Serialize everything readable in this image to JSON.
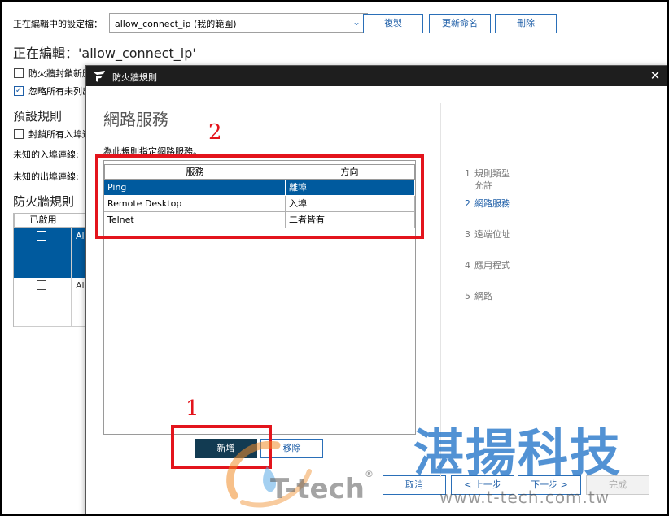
{
  "background_window": {
    "profile_label": "正在編輯中的設定檔：",
    "profile_value": "allow_connect_ip (我的範圍)",
    "copy_button": "複製",
    "rename_button": "更新命名",
    "delete_button": "刪除",
    "editing_title": "正在編輯：'allow_connect_ip'",
    "checkbox_block_new": "防火牆封鎖新應",
    "checkbox_ignore_unlisted": "忽略所有未列出",
    "default_rules_heading": "預設規則",
    "checkbox_block_inbound": "封鎖所有入埠連",
    "unknown_inbound": "未知的入埠連線:",
    "unknown_outbound": "未知的出埠連線:",
    "firewall_rules_heading": "防火牆規則",
    "rules_col_enabled": "已啟用",
    "rule_rows": [
      "All",
      "All"
    ]
  },
  "dialog": {
    "title": "防火牆規則",
    "heading": "網路服務",
    "description": "為此規則指定網路服務。",
    "table": {
      "columns": [
        "服務",
        "方向"
      ],
      "rows": [
        {
          "service": "Ping",
          "direction": "離埠",
          "selected": true
        },
        {
          "service": "Remote Desktop",
          "direction": "入埠",
          "selected": false
        },
        {
          "service": "Telnet",
          "direction": "二者皆有",
          "selected": false
        }
      ]
    },
    "add_button": "新增",
    "remove_button": "移除",
    "cancel_button": "取消",
    "back_button": "< 上一步",
    "next_button": "下一步 >",
    "finish_button": "完成",
    "steps": [
      {
        "num": "1",
        "label": "規則類型",
        "sub": "允許",
        "active": false
      },
      {
        "num": "2",
        "label": "網路服務",
        "sub": "",
        "active": true
      },
      {
        "num": "3",
        "label": "遠端位址",
        "sub": "",
        "active": false
      },
      {
        "num": "4",
        "label": "應用程式",
        "sub": "",
        "active": false
      },
      {
        "num": "5",
        "label": "網路",
        "sub": "",
        "active": false
      }
    ]
  },
  "annotations": {
    "label_1": "1",
    "label_2": "2",
    "color": "#e3141c"
  },
  "watermark": {
    "chinese": "湛揚科技",
    "brand": "T-tech",
    "registered": "®",
    "url": "www.t-tech.com.tw"
  },
  "colors": {
    "selection": "#005a9e",
    "primary_button": "#123b52",
    "accent": "#2a6fb8",
    "titlebar": "#1e1e1e"
  }
}
